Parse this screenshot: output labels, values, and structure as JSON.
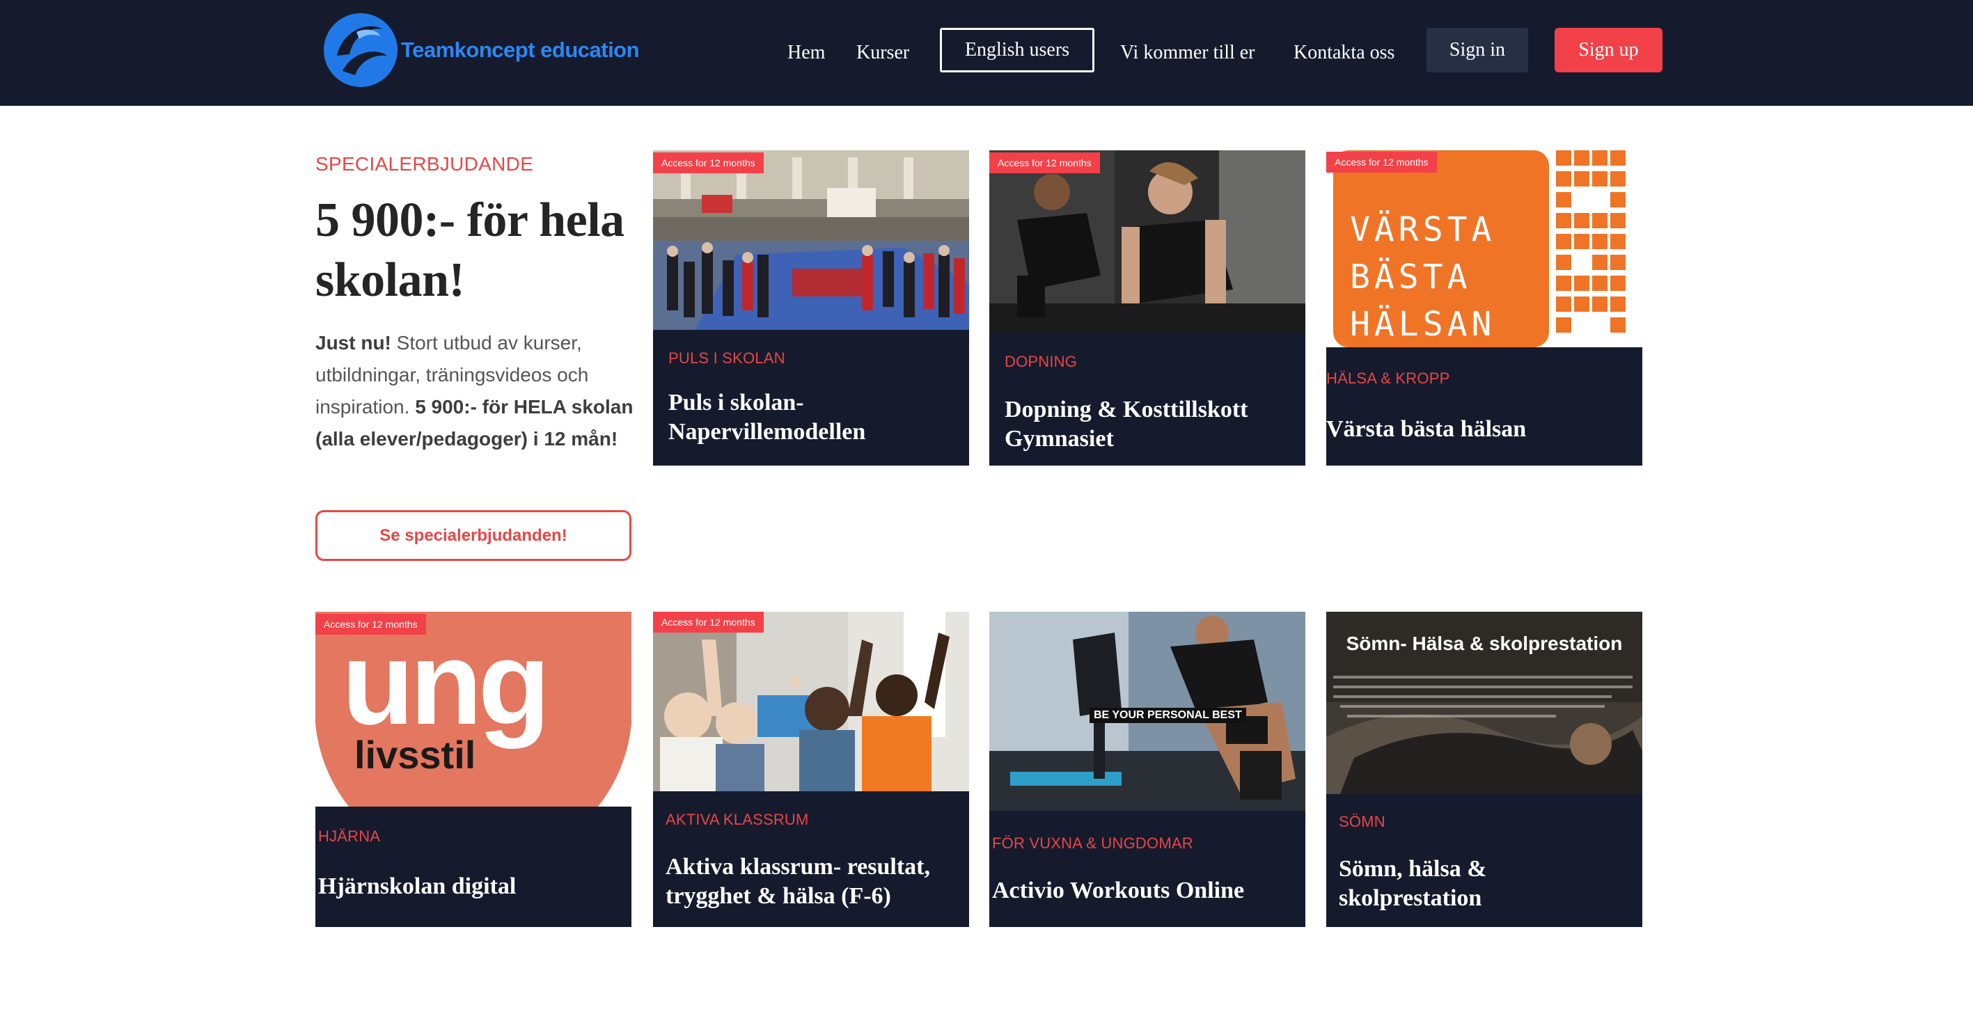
{
  "header": {
    "logo_text": "Teamkoncept education",
    "nav": [
      {
        "label": "Hem"
      },
      {
        "label": "Kurser"
      },
      {
        "label": "English users"
      },
      {
        "label": "Vi kommer till er"
      },
      {
        "label": "Kontakta oss"
      }
    ],
    "sign_in": "Sign in",
    "sign_up": "Sign up"
  },
  "promo": {
    "kicker": "SPECIALERBJUDANDE",
    "title": "5 900:- för hela skolan!",
    "body_lead": "Just nu!",
    "body_text": " Stort utbud av kurser, utbildningar, träningsvideos och inspiration. ",
    "body_bold": "5 900:- för HELA skolan (alla elever/pedagoger) i 12 mån!",
    "button": "Se specialerbjudanden!"
  },
  "cards": [
    {
      "badge": "Access for 12 months",
      "category": "PULS I SKOLAN",
      "title": "Puls i skolan- Napervillemodellen"
    },
    {
      "badge": "Access for 12 months",
      "category": "DOPNING",
      "title": "Dopning & Kosttillskott Gymnasiet"
    },
    {
      "badge": "Access for 12 months",
      "category": "HÄLSA & KROPP",
      "title": "Värsta bästa hälsan",
      "image_text": [
        "VÄRSTA",
        "BÄSTA",
        "HÄLSAN"
      ]
    },
    {
      "badge": "Access for 12 months",
      "category": "HJÄRNA",
      "title": "Hjärnskolan digital",
      "image_text": [
        "ung",
        "livsstil"
      ]
    },
    {
      "badge": "Access for 12 months",
      "category": "AKTIVA KLASSRUM",
      "title": "Aktiva klassrum- resultat, trygghet & hälsa (F-6)"
    },
    {
      "category": "FÖR VUXNA & UNGDOMAR",
      "title": "Activio Workouts Online",
      "image_text": [
        "BE YOUR PERSONAL BEST"
      ]
    },
    {
      "category": "SÖMN",
      "title": "Sömn, hälsa & skolprestation",
      "image_text": [
        "Sömn- Hälsa & skolprestation"
      ]
    }
  ],
  "colors": {
    "navy": "#151b2d",
    "accent": "#f34149",
    "orange": "#f07426",
    "coral": "#e4775f"
  }
}
